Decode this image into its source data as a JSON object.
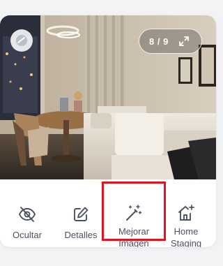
{
  "photo": {
    "alt": "Salón con sofá blanco, mesa redonda de madera y sillas",
    "counter": "8 / 9"
  },
  "icons": {
    "avatar": "avatar-icon",
    "expand": "expand-icon",
    "ocultar": "eye-off-icon",
    "detalles": "edit-icon",
    "mejorar": "magic-wand-icon",
    "home": "home-plus-icon"
  },
  "actions": {
    "ocultar": "Ocultar",
    "detalles": "Detalles",
    "mejorar": {
      "line1": "Mejorar",
      "line2": "Imagen"
    },
    "home": {
      "line1": "Home",
      "line2": "Staging"
    }
  },
  "colors": {
    "action_text": "#4a5262",
    "highlight": "#e0141c",
    "card_background": "#ffffff",
    "page_background": "#f2f3f5"
  }
}
